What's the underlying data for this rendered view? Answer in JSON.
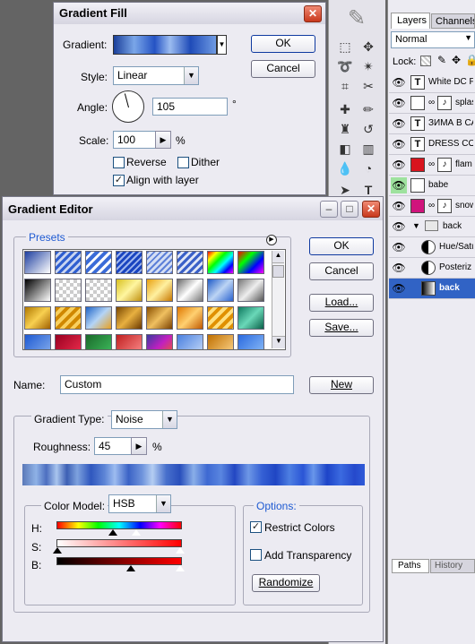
{
  "gradient_fill": {
    "title": "Gradient Fill",
    "gradient_label": "Gradient:",
    "style_label": "Style:",
    "style_value": "Linear",
    "angle_label": "Angle:",
    "angle_value": "105",
    "angle_unit": "°",
    "scale_label": "Scale:",
    "scale_value": "100",
    "scale_unit": "%",
    "reverse_label": "Reverse",
    "dither_label": "Dither",
    "align_label": "Align with layer",
    "ok": "OK",
    "cancel": "Cancel"
  },
  "gradient_editor": {
    "title": "Gradient Editor",
    "presets_label": "Presets",
    "ok": "OK",
    "cancel": "Cancel",
    "load": "Load...",
    "save": "Save...",
    "name_label": "Name:",
    "name_value": "Custom",
    "new_label": "New",
    "gradient_type_label": "Gradient Type:",
    "gradient_type_value": "Noise",
    "roughness_label": "Roughness:",
    "roughness_value": "45",
    "roughness_unit": "%",
    "color_model_label": "Color Model:",
    "color_model_value": "HSB",
    "h_label": "H:",
    "s_label": "S:",
    "b_label": "B:",
    "options_label": "Options:",
    "restrict_label": "Restrict Colors",
    "transparency_label": "Add Transparency",
    "randomize_label": "Randomize"
  },
  "layers_panel": {
    "tab_layers": "Layers",
    "tab_channels": "Channels",
    "blend_mode": "Normal",
    "lock_label": "Lock:",
    "layers": [
      {
        "name": "White DC F",
        "thumb": "T"
      },
      {
        "name": "splas",
        "thumb": ""
      },
      {
        "name": "ЗИМА В СА",
        "thumb": "T"
      },
      {
        "name": "DRESS COD",
        "thumb": "T"
      },
      {
        "name": "flam",
        "thumb": ""
      },
      {
        "name": "babe",
        "thumb": ""
      },
      {
        "name": "snow",
        "thumb": ""
      },
      {
        "name": "back",
        "thumb": ""
      },
      {
        "name": "Hue/Satu",
        "thumb": ""
      },
      {
        "name": "Posteriz",
        "thumb": ""
      },
      {
        "name": "back",
        "thumb": ""
      }
    ],
    "tab_paths": "Paths",
    "tab_history": "History"
  },
  "colors": {
    "selected_layer": "#3163c5",
    "dialog_bg": "#ecebf2",
    "button_border": "#0f3aa0"
  }
}
